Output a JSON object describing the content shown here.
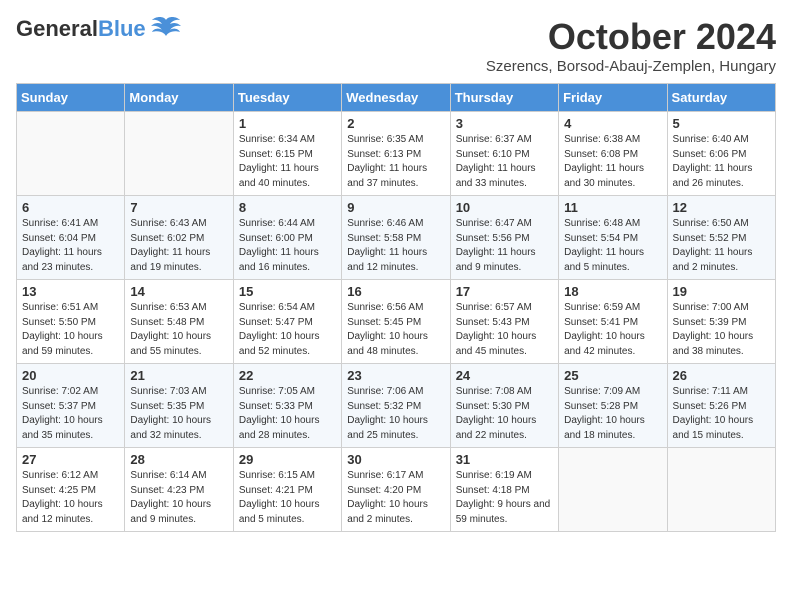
{
  "header": {
    "logo_general": "General",
    "logo_blue": "Blue",
    "month_title": "October 2024",
    "location": "Szerencs, Borsod-Abauj-Zemplen, Hungary"
  },
  "days_of_week": [
    "Sunday",
    "Monday",
    "Tuesday",
    "Wednesday",
    "Thursday",
    "Friday",
    "Saturday"
  ],
  "weeks": [
    [
      {
        "day": "",
        "info": ""
      },
      {
        "day": "",
        "info": ""
      },
      {
        "day": "1",
        "info": "Sunrise: 6:34 AM\nSunset: 6:15 PM\nDaylight: 11 hours and 40 minutes."
      },
      {
        "day": "2",
        "info": "Sunrise: 6:35 AM\nSunset: 6:13 PM\nDaylight: 11 hours and 37 minutes."
      },
      {
        "day": "3",
        "info": "Sunrise: 6:37 AM\nSunset: 6:10 PM\nDaylight: 11 hours and 33 minutes."
      },
      {
        "day": "4",
        "info": "Sunrise: 6:38 AM\nSunset: 6:08 PM\nDaylight: 11 hours and 30 minutes."
      },
      {
        "day": "5",
        "info": "Sunrise: 6:40 AM\nSunset: 6:06 PM\nDaylight: 11 hours and 26 minutes."
      }
    ],
    [
      {
        "day": "6",
        "info": "Sunrise: 6:41 AM\nSunset: 6:04 PM\nDaylight: 11 hours and 23 minutes."
      },
      {
        "day": "7",
        "info": "Sunrise: 6:43 AM\nSunset: 6:02 PM\nDaylight: 11 hours and 19 minutes."
      },
      {
        "day": "8",
        "info": "Sunrise: 6:44 AM\nSunset: 6:00 PM\nDaylight: 11 hours and 16 minutes."
      },
      {
        "day": "9",
        "info": "Sunrise: 6:46 AM\nSunset: 5:58 PM\nDaylight: 11 hours and 12 minutes."
      },
      {
        "day": "10",
        "info": "Sunrise: 6:47 AM\nSunset: 5:56 PM\nDaylight: 11 hours and 9 minutes."
      },
      {
        "day": "11",
        "info": "Sunrise: 6:48 AM\nSunset: 5:54 PM\nDaylight: 11 hours and 5 minutes."
      },
      {
        "day": "12",
        "info": "Sunrise: 6:50 AM\nSunset: 5:52 PM\nDaylight: 11 hours and 2 minutes."
      }
    ],
    [
      {
        "day": "13",
        "info": "Sunrise: 6:51 AM\nSunset: 5:50 PM\nDaylight: 10 hours and 59 minutes."
      },
      {
        "day": "14",
        "info": "Sunrise: 6:53 AM\nSunset: 5:48 PM\nDaylight: 10 hours and 55 minutes."
      },
      {
        "day": "15",
        "info": "Sunrise: 6:54 AM\nSunset: 5:47 PM\nDaylight: 10 hours and 52 minutes."
      },
      {
        "day": "16",
        "info": "Sunrise: 6:56 AM\nSunset: 5:45 PM\nDaylight: 10 hours and 48 minutes."
      },
      {
        "day": "17",
        "info": "Sunrise: 6:57 AM\nSunset: 5:43 PM\nDaylight: 10 hours and 45 minutes."
      },
      {
        "day": "18",
        "info": "Sunrise: 6:59 AM\nSunset: 5:41 PM\nDaylight: 10 hours and 42 minutes."
      },
      {
        "day": "19",
        "info": "Sunrise: 7:00 AM\nSunset: 5:39 PM\nDaylight: 10 hours and 38 minutes."
      }
    ],
    [
      {
        "day": "20",
        "info": "Sunrise: 7:02 AM\nSunset: 5:37 PM\nDaylight: 10 hours and 35 minutes."
      },
      {
        "day": "21",
        "info": "Sunrise: 7:03 AM\nSunset: 5:35 PM\nDaylight: 10 hours and 32 minutes."
      },
      {
        "day": "22",
        "info": "Sunrise: 7:05 AM\nSunset: 5:33 PM\nDaylight: 10 hours and 28 minutes."
      },
      {
        "day": "23",
        "info": "Sunrise: 7:06 AM\nSunset: 5:32 PM\nDaylight: 10 hours and 25 minutes."
      },
      {
        "day": "24",
        "info": "Sunrise: 7:08 AM\nSunset: 5:30 PM\nDaylight: 10 hours and 22 minutes."
      },
      {
        "day": "25",
        "info": "Sunrise: 7:09 AM\nSunset: 5:28 PM\nDaylight: 10 hours and 18 minutes."
      },
      {
        "day": "26",
        "info": "Sunrise: 7:11 AM\nSunset: 5:26 PM\nDaylight: 10 hours and 15 minutes."
      }
    ],
    [
      {
        "day": "27",
        "info": "Sunrise: 6:12 AM\nSunset: 4:25 PM\nDaylight: 10 hours and 12 minutes."
      },
      {
        "day": "28",
        "info": "Sunrise: 6:14 AM\nSunset: 4:23 PM\nDaylight: 10 hours and 9 minutes."
      },
      {
        "day": "29",
        "info": "Sunrise: 6:15 AM\nSunset: 4:21 PM\nDaylight: 10 hours and 5 minutes."
      },
      {
        "day": "30",
        "info": "Sunrise: 6:17 AM\nSunset: 4:20 PM\nDaylight: 10 hours and 2 minutes."
      },
      {
        "day": "31",
        "info": "Sunrise: 6:19 AM\nSunset: 4:18 PM\nDaylight: 9 hours and 59 minutes."
      },
      {
        "day": "",
        "info": ""
      },
      {
        "day": "",
        "info": ""
      }
    ]
  ]
}
